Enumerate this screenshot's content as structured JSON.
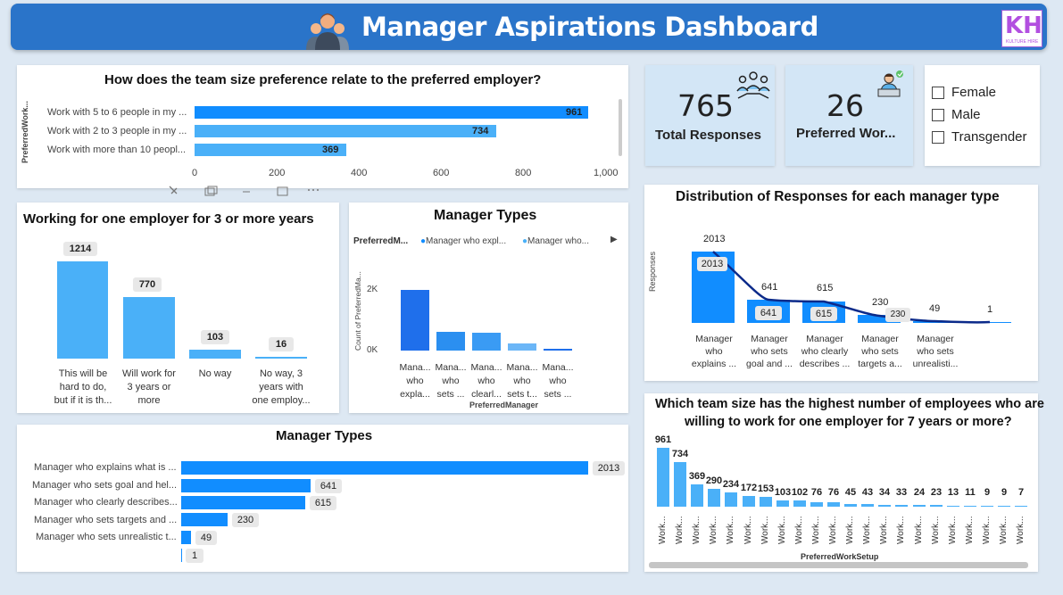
{
  "header": {
    "title": "Manager Aspirations Dashboard",
    "logo": "KH",
    "logo_sub": "KULTURE HIRE"
  },
  "team_pref_card": {
    "title": "How does the team size preference relate to the preferred employer?",
    "yaxis_label": "PreferredWork...",
    "chart_data": {
      "type": "bar",
      "orientation": "horizontal",
      "categories": [
        "Work with 5 to 6 people in my ...",
        "Work with 2 to 3 people in my ...",
        "Work with more than 10 peopl..."
      ],
      "values": [
        961,
        734,
        369
      ],
      "xlim": [
        0,
        1000
      ],
      "ticks": [
        "0",
        "200",
        "400",
        "600",
        "800",
        "1,000"
      ]
    }
  },
  "kpi_total": {
    "value": "765",
    "label": "Total Responses"
  },
  "kpi_work": {
    "value": "26",
    "label": "Preferred Wor..."
  },
  "gender_slicer": {
    "options": [
      "Female",
      "Male",
      "Transgender"
    ]
  },
  "distribution_card": {
    "title": "Distribution of Responses for each manager type",
    "yaxis_label": "Responses",
    "chart_data": {
      "type": "bar",
      "categories": [
        [
          "Manager",
          "who",
          "explains ..."
        ],
        [
          "Manager",
          "who sets",
          "goal and ..."
        ],
        [
          "Manager",
          "who clearly",
          "describes ..."
        ],
        [
          "Manager",
          "who sets",
          "targets a..."
        ],
        [
          "Manager",
          "who sets",
          "unrealisti..."
        ]
      ],
      "values": [
        2013,
        641,
        615,
        230,
        49,
        1
      ],
      "labels": [
        "2013",
        "641",
        "615",
        "230",
        "49",
        "1"
      ]
    }
  },
  "working_card": {
    "title": "Working for one employer for 3 or more years",
    "chart_data": {
      "type": "bar",
      "categories": [
        [
          "This will be",
          "hard to do,",
          "but if it is th..."
        ],
        [
          "Will work for",
          "3 years or",
          "more"
        ],
        [
          "No way"
        ],
        [
          "No way, 3",
          "years with",
          "one employ..."
        ]
      ],
      "values": [
        1214,
        770,
        103,
        16
      ]
    }
  },
  "manager_types_col": {
    "title": "Manager Types",
    "legend_title": "PreferredM...",
    "legend_items": [
      "Manager who expl...",
      "Manager who..."
    ],
    "yaxis_label": "Count of PreferredMa...",
    "xaxis_label": "PreferredManager",
    "yticks": [
      "2K",
      "0K"
    ],
    "chart_data": {
      "type": "bar",
      "categories": [
        [
          "Mana...",
          "who",
          "expla..."
        ],
        [
          "Mana...",
          "who",
          "sets ..."
        ],
        [
          "Mana...",
          "who",
          "clearl..."
        ],
        [
          "Mana...",
          "who",
          "sets t..."
        ],
        [
          "Mana...",
          "who",
          "sets ..."
        ]
      ],
      "values": [
        2013,
        641,
        615,
        230,
        49,
        1
      ]
    }
  },
  "manager_types_bar": {
    "title": "Manager Types",
    "chart_data": {
      "type": "bar",
      "orientation": "horizontal",
      "categories": [
        "Manager who explains what is ...",
        "Manager who sets goal and hel...",
        "Manager who clearly describes...",
        "Manager who sets targets and ...",
        "Manager who sets unrealistic t...",
        ""
      ],
      "values": [
        2013,
        641,
        615,
        230,
        49,
        1
      ],
      "labels": [
        "2013",
        "641",
        "615",
        "230",
        "49",
        "1"
      ]
    }
  },
  "team_size_card": {
    "title_line1": "Which team size has the highest number of employees who are",
    "title_line2": "willing to work for one employer for 7 years or more?",
    "xaxis_label": "PreferredWorkSetup",
    "chart_data": {
      "type": "bar",
      "category_label": "Work...",
      "values": [
        961,
        734,
        369,
        290,
        234,
        172,
        153,
        103,
        102,
        76,
        76,
        45,
        43,
        34,
        33,
        24,
        23,
        13,
        11,
        9,
        9,
        7
      ],
      "labels": [
        "961",
        "734",
        "369",
        "290",
        "234",
        "172",
        "153",
        "103",
        "102",
        "76",
        "76",
        "45",
        "43",
        "34",
        "33",
        "24",
        "23",
        "13",
        "11",
        "9",
        "9",
        "7"
      ]
    }
  }
}
